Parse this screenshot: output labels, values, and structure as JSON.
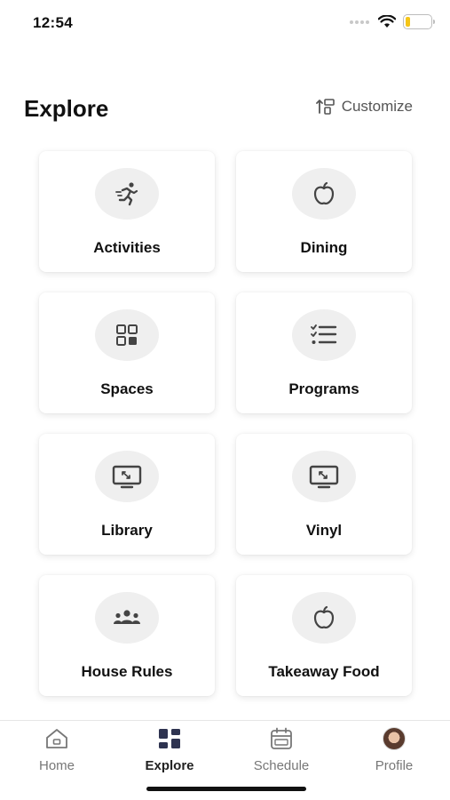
{
  "status_bar": {
    "time": "12:54",
    "battery_level": 0.2,
    "battery_color": "#f5c518"
  },
  "header": {
    "title": "Explore",
    "customize_label": "Customize",
    "customize_icon": "sort-layout-icon"
  },
  "cards": [
    {
      "label": "Activities",
      "icon": "running-person-icon"
    },
    {
      "label": "Dining",
      "icon": "apple-icon"
    },
    {
      "label": "Spaces",
      "icon": "grid-squares-icon"
    },
    {
      "label": "Programs",
      "icon": "checklist-icon"
    },
    {
      "label": "Library",
      "icon": "monitor-icon"
    },
    {
      "label": "Vinyl",
      "icon": "monitor-icon"
    },
    {
      "label": "House Rules",
      "icon": "people-group-icon"
    },
    {
      "label": "Takeaway Food",
      "icon": "apple-icon"
    }
  ],
  "tab_bar": {
    "active": "Explore",
    "tabs": [
      {
        "label": "Home",
        "icon": "home-icon"
      },
      {
        "label": "Explore",
        "icon": "explore-grid-icon"
      },
      {
        "label": "Schedule",
        "icon": "calendar-icon"
      },
      {
        "label": "Profile",
        "icon": "avatar"
      }
    ]
  },
  "colors": {
    "icon_circle": "#efefef",
    "icon_stroke": "#444444",
    "text": "#111111",
    "muted": "#777777"
  }
}
